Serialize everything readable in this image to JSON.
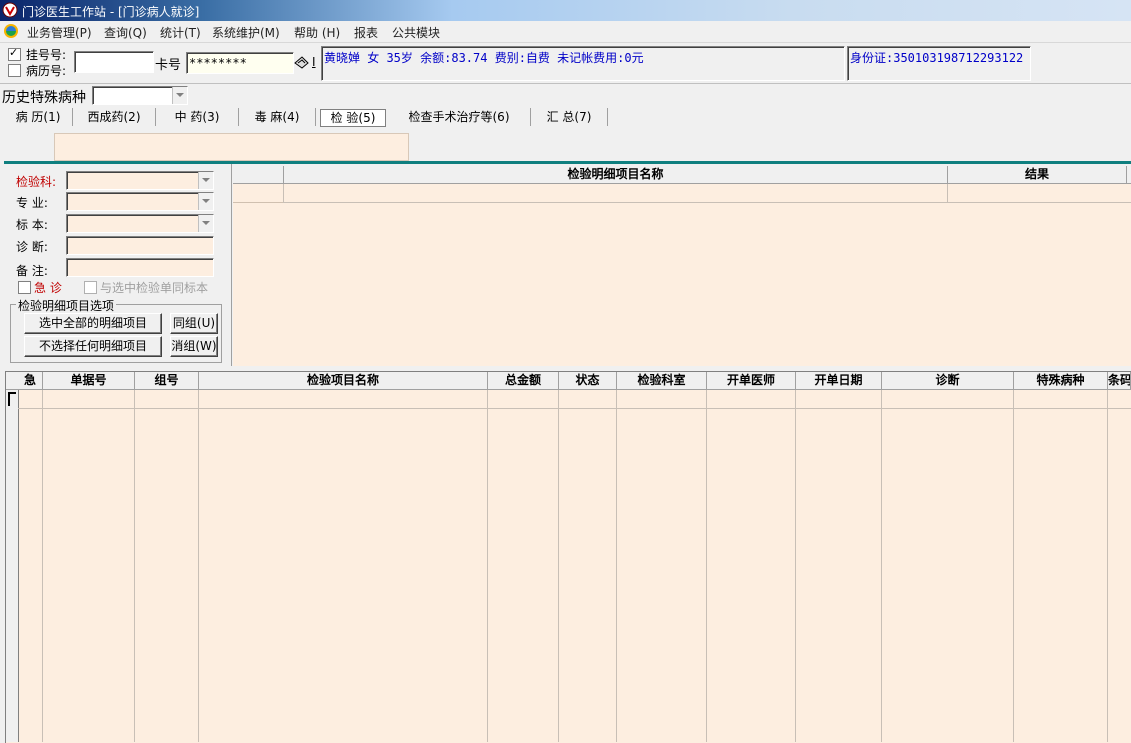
{
  "window": {
    "title": "门诊医生工作站 - [门诊病人就诊]"
  },
  "menu": [
    "业务管理(P)",
    "查询(Q)",
    "统计(T)",
    "系统维护(M)",
    "帮助 (H)",
    "报表",
    "公共模块"
  ],
  "patient": {
    "reg_label": "挂号号:",
    "record_label": "病历号:",
    "reg_checked": true,
    "record_checked": false,
    "card_label": "卡号",
    "card_value": "********",
    "info": "黄晓婵 女 35岁 余额:83.74 费别:自费 未记帐费用:0元",
    "id_card": "身份证:350103198712293122"
  },
  "history": {
    "label": "历史特殊病种",
    "value": ""
  },
  "tabs": [
    "病 历(1)",
    "西成药(2)",
    "中 药(3)",
    "毒 麻(4)",
    "检 验(5)",
    "检查手术治疗等(6)",
    "汇 总(7)"
  ],
  "active_tab": 4,
  "form": {
    "dept_label": "检验科:",
    "major_label": "专  业:",
    "specimen_label": "标  本:",
    "diagnosis_label": "诊  断:",
    "note_label": "备  注:",
    "urgent_label": "急  诊",
    "same_specimen_label": "与选中检验单同标本"
  },
  "options_group": {
    "title": "检验明细项目选项",
    "select_all": "选中全部的明细项目",
    "select_none": "不选择任何明细项目",
    "same_group": "同组(U)",
    "ungroup": "消组(W)"
  },
  "detail_grid": {
    "columns": [
      "检验明细项目名称",
      "结果"
    ]
  },
  "main_grid": {
    "columns": [
      "急",
      "单据号",
      "组号",
      "检验项目名称",
      "总金额",
      "状态",
      "检验科室",
      "开单医师",
      "开单日期",
      "诊断",
      "特殊病种",
      "条码"
    ]
  }
}
